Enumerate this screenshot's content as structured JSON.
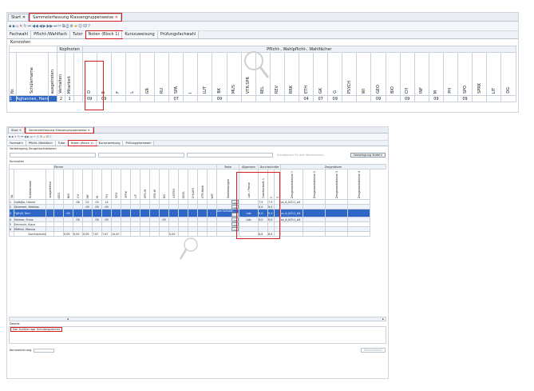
{
  "top": {
    "tabs": [
      "Start",
      "Sammelerfassung Klassengruppenweise"
    ],
    "subtabs": [
      "Fachwahl",
      "Pflicht-/Wahlfach",
      "Tutor",
      "Noten (Block 1)",
      "Kurszuweisung",
      "Prüfungsfachwahl"
    ],
    "section_label": "Kursnoten",
    "group_kopfnoten": "Kopfnoten",
    "group_pflicht": "Pflicht-, Wahlpflicht-, Wahlfächer",
    "col_nr": "Nr.",
    "col_name": "Schülername",
    "col_ausgetreten": "ausgetreten",
    "col_verhalten": "Verhalten",
    "col_mitarbeit": "Mitarbeit",
    "subjects": [
      "D",
      "E",
      "F",
      "L",
      "GR",
      "RU",
      "SPA",
      "I",
      "LUT",
      "BK",
      "MUS",
      "VTR:SPR",
      "REL",
      "REV",
      "RRK",
      "ETH",
      "GK",
      "G",
      "PSYCH",
      "WI",
      "GEO",
      "BIO",
      "CH",
      "INF",
      "M",
      "PH",
      "SPO",
      "SPRK",
      "LIT",
      "DG"
    ],
    "row": {
      "nr": "1",
      "name": "Aghannes, Hannes",
      "verhalten": "2",
      "mitarbeit": "1",
      "grades": [
        "09",
        "09",
        "",
        "",
        "",
        "",
        "07",
        "",
        "",
        "09",
        "",
        "",
        "",
        "",
        "",
        "04",
        "07",
        "09",
        "",
        "",
        "09",
        "",
        "09",
        "",
        "09",
        "",
        "09",
        "",
        "",
        ""
      ]
    }
  },
  "bottom": {
    "tabs": [
      "Start",
      "Sammelerfassung Klassengruppenweise"
    ],
    "subtabs": [
      "Fachwahl",
      "Pflicht-/Wahlfach",
      "Tutor",
      "Noten (Block 1)",
      "Kurszuweisung",
      "Prüfungsfachwahl"
    ],
    "vorlage_label": "Vorbelegung Zeugnisschablonen",
    "btn_schablonen": "Schablonen für alle übernehmen",
    "btn_vorbelegung": "Vorbelegung ändern",
    "section_label": "Kursnoten",
    "group_faecher": "Fächer",
    "group_texte": "Texte",
    "group_allgemein": "Allgemein",
    "group_durchschnitte": "Durchschnitte",
    "group_zeugnisform": "Zeugnisform",
    "col_nr": "Nr.",
    "col_name": "Schülername",
    "col_ausgetreten": "ausgetreten",
    "subjects": [
      "GEO",
      "BIO",
      "CH",
      "INF",
      "M",
      "PH",
      "SPO",
      "SPRK",
      "LIT",
      "SPO-M",
      "SPO-W",
      "DG",
      "ASTRO",
      "GEOL",
      "CHLAYS",
      "VTR:Math",
      "WIT"
    ],
    "col_bemerkungen": "Bemerkungen",
    "col_lob": "Lob / Preise",
    "col_durchschnitt": "Durchschnitt 1",
    "col_d2": "2",
    "col_d3": "3",
    "col_zs1": "Zeugnisschablone 1",
    "col_zs2": "Zeugnisschablone 2",
    "col_zs3": "Zeugnisschablone 3",
    "col_zs4": "Zeugnisschablone 4",
    "col_zeugnisform": "Zeugnisform",
    "rows": [
      {
        "nr": "1",
        "name": "Ugfbjfja, Hanne",
        "g": [
          "",
          "",
          "08",
          "02",
          "03",
          "14",
          "",
          "",
          "",
          "",
          "",
          "",
          "",
          "",
          "",
          "",
          ""
        ],
        "bem": "",
        "lob": "",
        "d1": "7,9",
        "d2": "7,9",
        "zs": "zz_A_KZ11_A4"
      },
      {
        "nr": "2",
        "name": "Steemerl, Mathias",
        "g": [
          "",
          "",
          "",
          "09",
          "09",
          "09",
          "",
          "",
          "",
          "",
          "",
          "",
          "",
          "",
          "",
          "",
          ""
        ],
        "bem": "",
        "lob": "",
        "d1": "9,0",
        "d2": "9,0",
        "zs": ""
      },
      {
        "nr": "3",
        "name": "Tgfhjfl, Tom",
        "g": [
          "",
          "09",
          "",
          "",
          "",
          "",
          "",
          "",
          "",
          "",
          "",
          "",
          "",
          "",
          "",
          "",
          ""
        ],
        "bem": "Der Schüler...",
        "lob": "Lob",
        "d1": "9,0",
        "d2": "9,0",
        "zs": "zz_A_KZ11_A4"
      },
      {
        "nr": "4",
        "name": "Heimer, Franz",
        "g": [
          "",
          "",
          "09",
          "",
          "09",
          "09",
          "",
          "",
          "",
          "",
          "",
          "09",
          "",
          "",
          "",
          "",
          ""
        ],
        "bem": "",
        "lob": "Lob",
        "d1": "9,0",
        "d2": "9,0",
        "zs": "zz_A_KZ11_A4"
      },
      {
        "nr": "5",
        "name": "Emmrich, Klara",
        "g": [
          "",
          "",
          "",
          "",
          "",
          "",
          "",
          "",
          "",
          "",
          "",
          "",
          "",
          "",
          "",
          "",
          ""
        ],
        "bem": "",
        "lob": "",
        "d1": "",
        "d2": "",
        "zs": ""
      },
      {
        "nr": "6",
        "name": "Mitttini, Marcus",
        "g": [
          "",
          "",
          "",
          "",
          "",
          "",
          "",
          "",
          "",
          "",
          "",
          "",
          "",
          "",
          "",
          "",
          ""
        ],
        "bem": "",
        "lob": "",
        "d1": "",
        "d2": "",
        "zs": ""
      }
    ],
    "avg_label": "Durchschnitt",
    "avg": [
      "",
      "9,00",
      "9,00",
      "9,00",
      "7,67",
      "7,67",
      "10,67",
      "",
      "",
      "",
      "",
      "",
      "5,00",
      "",
      "",
      "",
      ""
    ],
    "avg_d1": "8,6",
    "avg_d2": "8,6",
    "details_label": "Details",
    "details_text": "Der Schüler war Schülersprecher",
    "footer_left": "Kennzeichnung",
    "btn_uebernehmen": "Übernehmen"
  }
}
